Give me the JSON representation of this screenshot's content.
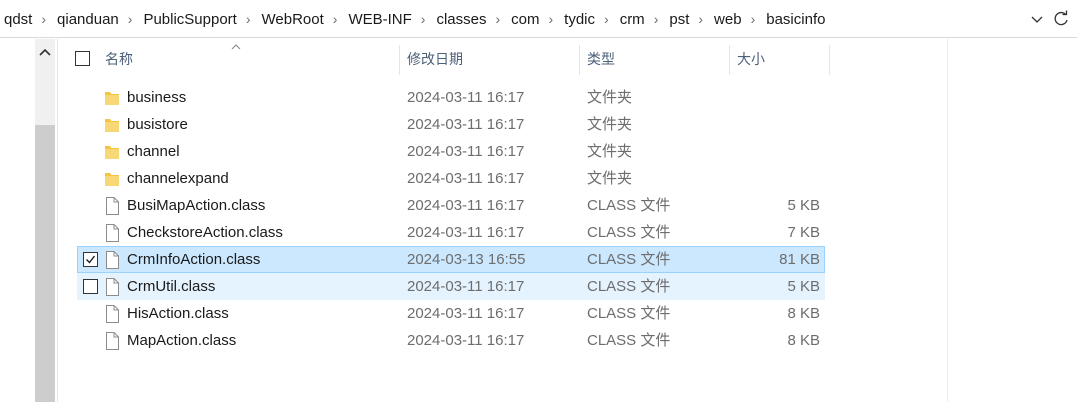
{
  "breadcrumb": [
    "qdst",
    "qianduan",
    "PublicSupport",
    "WebRoot",
    "WEB-INF",
    "classes",
    "com",
    "tydic",
    "crm",
    "pst",
    "web",
    "basicinfo"
  ],
  "columns": {
    "name": "名称",
    "modified": "修改日期",
    "type": "类型",
    "size": "大小"
  },
  "files": [
    {
      "name": "business",
      "kind": "folder",
      "modified": "2024-03-11 16:17",
      "type": "文件夹",
      "size": "",
      "selected": false,
      "hover": false
    },
    {
      "name": "busistore",
      "kind": "folder",
      "modified": "2024-03-11 16:17",
      "type": "文件夹",
      "size": "",
      "selected": false,
      "hover": false
    },
    {
      "name": "channel",
      "kind": "folder",
      "modified": "2024-03-11 16:17",
      "type": "文件夹",
      "size": "",
      "selected": false,
      "hover": false
    },
    {
      "name": "channelexpand",
      "kind": "folder",
      "modified": "2024-03-11 16:17",
      "type": "文件夹",
      "size": "",
      "selected": false,
      "hover": false
    },
    {
      "name": "BusiMapAction.class",
      "kind": "file",
      "modified": "2024-03-11 16:17",
      "type": "CLASS 文件",
      "size": "5 KB",
      "selected": false,
      "hover": false
    },
    {
      "name": "CheckstoreAction.class",
      "kind": "file",
      "modified": "2024-03-11 16:17",
      "type": "CLASS 文件",
      "size": "7 KB",
      "selected": false,
      "hover": false
    },
    {
      "name": "CrmInfoAction.class",
      "kind": "file",
      "modified": "2024-03-13 16:55",
      "type": "CLASS 文件",
      "size": "81 KB",
      "selected": true,
      "hover": false
    },
    {
      "name": "CrmUtil.class",
      "kind": "file",
      "modified": "2024-03-11 16:17",
      "type": "CLASS 文件",
      "size": "5 KB",
      "selected": false,
      "hover": true
    },
    {
      "name": "HisAction.class",
      "kind": "file",
      "modified": "2024-03-11 16:17",
      "type": "CLASS 文件",
      "size": "8 KB",
      "selected": false,
      "hover": false
    },
    {
      "name": "MapAction.class",
      "kind": "file",
      "modified": "2024-03-11 16:17",
      "type": "CLASS 文件",
      "size": "8 KB",
      "selected": false,
      "hover": false
    }
  ],
  "colors": {
    "selected_bg": "#cce8ff",
    "hover_bg": "#e5f3ff",
    "folder": "#f4c542",
    "header_text": "#4c607a"
  }
}
